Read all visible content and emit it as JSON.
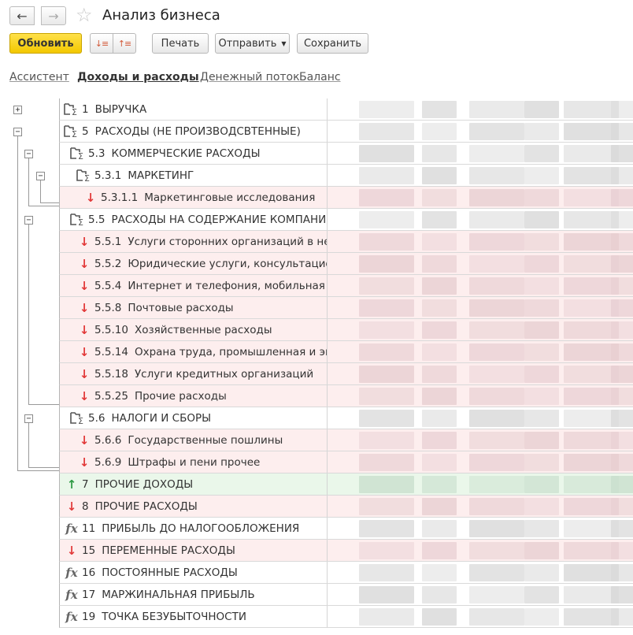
{
  "window": {
    "title": "Анализ бизнеса"
  },
  "toolbar": {
    "refresh_label": "Обновить",
    "print_label": "Печать",
    "send_label": "Отправить",
    "save_label": "Сохранить"
  },
  "tabs": [
    {
      "label": "Ассистент",
      "active": false
    },
    {
      "label": "Доходы и расходы",
      "active": true
    },
    {
      "label": "Денежный поток",
      "active": false
    },
    {
      "label": "Баланс",
      "active": false
    }
  ],
  "rows": [
    {
      "num": "1",
      "text": "ВЫРУЧКА",
      "kind": "group",
      "level": 0
    },
    {
      "num": "5",
      "text": "РАСХОДЫ (НЕ ПРОИЗВОДСВТЕННЫЕ)",
      "kind": "group",
      "level": 0
    },
    {
      "num": "5.3",
      "text": "КОММЕРЧЕСКИЕ РАСХОДЫ",
      "kind": "group",
      "level": 1
    },
    {
      "num": "5.3.1",
      "text": "МАРКЕТИНГ",
      "kind": "group",
      "level": 2
    },
    {
      "num": "5.3.1.1",
      "text": "Маркетинговые исследования",
      "kind": "expense",
      "level": 3
    },
    {
      "num": "5.5",
      "text": "РАСХОДЫ НА СОДЕРЖАНИЕ КОМПАНИИ",
      "kind": "group",
      "level": 1
    },
    {
      "num": "5.5.1",
      "text": "Услуги сторонних организаций в непроизводственной сфере",
      "kind": "expense",
      "level": 2
    },
    {
      "num": "5.5.2",
      "text": "Юридические услуги, консультационно-информационные",
      "kind": "expense",
      "level": 2
    },
    {
      "num": "5.5.4",
      "text": "Интернет и телефония, мобильная связь",
      "kind": "expense",
      "level": 2
    },
    {
      "num": "5.5.8",
      "text": "Почтовые расходы",
      "kind": "expense",
      "level": 2
    },
    {
      "num": "5.5.10",
      "text": "Хозяйственные расходы",
      "kind": "expense",
      "level": 2
    },
    {
      "num": "5.5.14",
      "text": "Охрана труда, промышленная и экологическая",
      "kind": "expense",
      "level": 2
    },
    {
      "num": "5.5.18",
      "text": "Услуги кредитных организаций",
      "kind": "expense",
      "level": 2
    },
    {
      "num": "5.5.25",
      "text": "Прочие расходы",
      "kind": "expense",
      "level": 2
    },
    {
      "num": "5.6",
      "text": "НАЛОГИ И СБОРЫ",
      "kind": "group",
      "level": 1
    },
    {
      "num": "5.6.6",
      "text": "Государственные пошлины",
      "kind": "expense",
      "level": 2
    },
    {
      "num": "5.6.9",
      "text": "Штрафы и пени прочее",
      "kind": "expense",
      "level": 2
    },
    {
      "num": "7",
      "text": "ПРОЧИЕ ДОХОДЫ",
      "kind": "income",
      "level": 0
    },
    {
      "num": "8",
      "text": "ПРОЧИЕ РАСХОДЫ",
      "kind": "expense",
      "level": 0
    },
    {
      "num": "11",
      "text": "ПРИБЫЛЬ ДО НАЛОГООБЛОЖЕНИЯ",
      "kind": "formula",
      "level": 0
    },
    {
      "num": "15",
      "text": "ПЕРЕМЕННЫЕ РАСХОДЫ",
      "kind": "expense",
      "level": 0
    },
    {
      "num": "16",
      "text": "ПОСТОЯННЫЕ РАСХОДЫ",
      "kind": "formula",
      "level": 0
    },
    {
      "num": "17",
      "text": "МАРЖИНАЛЬНАЯ ПРИБЫЛЬ",
      "kind": "formula",
      "level": 0
    },
    {
      "num": "19",
      "text": "ТОЧКА БЕЗУБЫТОЧНОСТИ",
      "kind": "formula",
      "level": 0
    }
  ],
  "colors": {
    "accent_button": "#f3c800",
    "expense_row": "#fdeeee",
    "income_row": "#eaf7ea",
    "expense_arrow": "#e23a3a",
    "income_arrow": "#2f9a45"
  }
}
